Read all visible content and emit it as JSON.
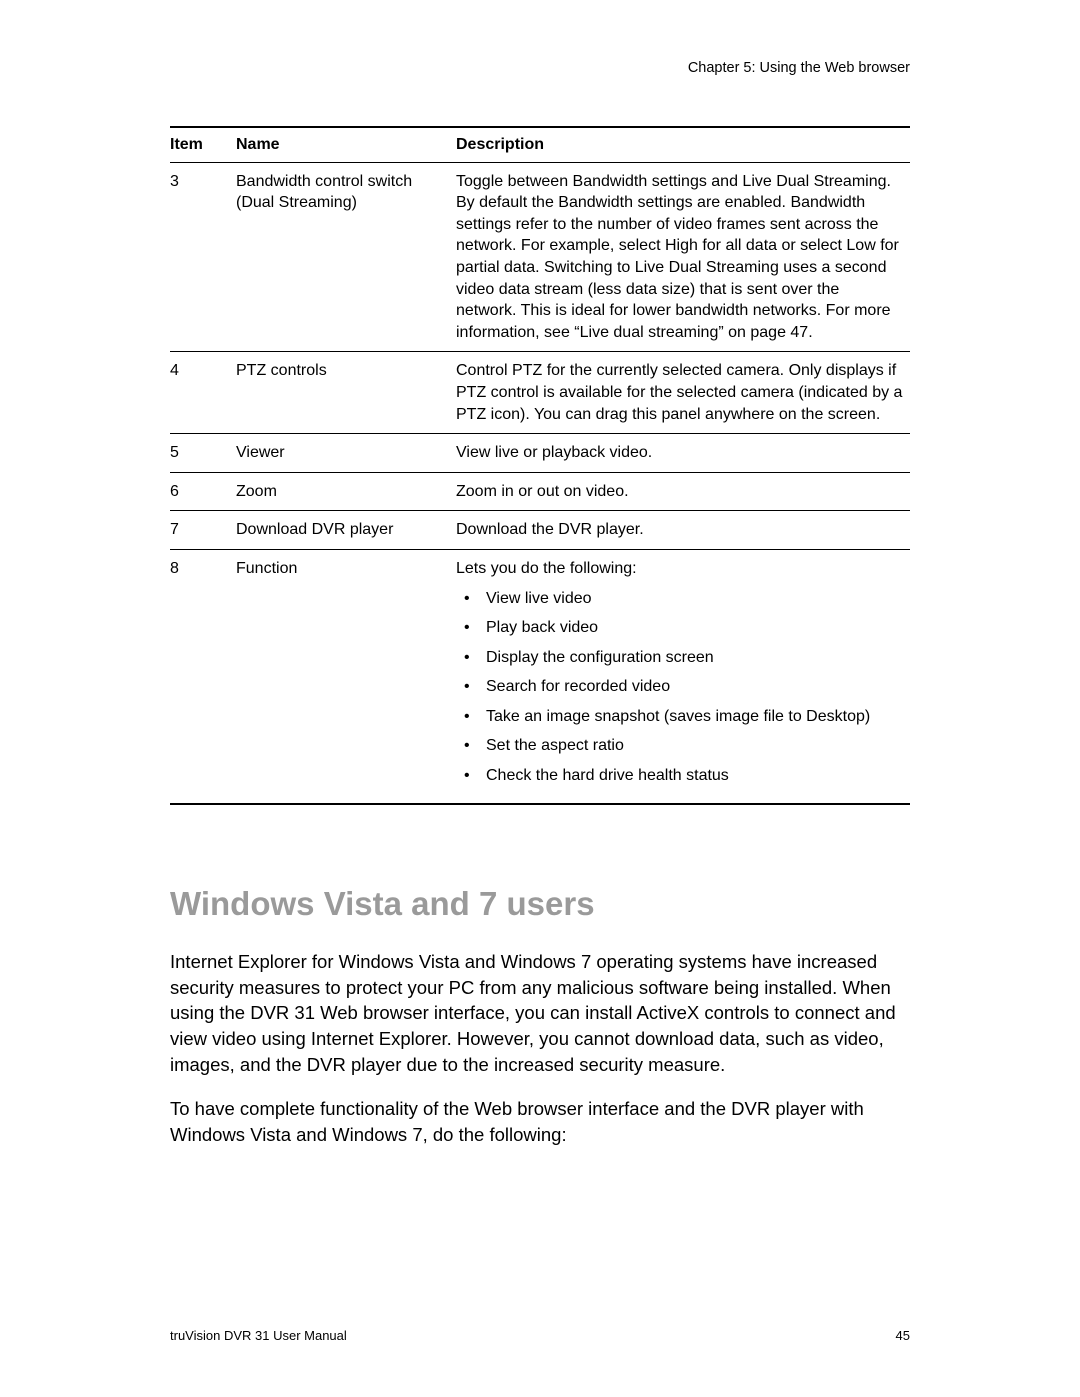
{
  "chapter_header": "Chapter 5: Using the Web browser",
  "table": {
    "headers": {
      "item": "Item",
      "name": "Name",
      "description": "Description"
    },
    "rows": [
      {
        "item": "3",
        "name": "Bandwidth control switch (Dual Streaming)",
        "desc": "Toggle between Bandwidth settings and Live Dual Streaming. By default the Bandwidth settings are enabled. Bandwidth settings refer to the number of video frames sent across the network. For example, select High for all data or select Low for partial data. Switching to Live Dual Streaming uses a second video data stream (less data size) that is sent over the network. This is ideal for lower bandwidth networks. For more information, see “Live dual streaming” on page 47."
      },
      {
        "item": "4",
        "name": "PTZ controls",
        "desc": "Control PTZ for the currently selected camera. Only displays if PTZ control is available for the selected camera (indicated by a PTZ icon). You can drag this panel anywhere on the screen."
      },
      {
        "item": "5",
        "name": "Viewer",
        "desc": "View live or playback video."
      },
      {
        "item": "6",
        "name": "Zoom",
        "desc": "Zoom in or out on video."
      },
      {
        "item": "7",
        "name": "Download DVR player",
        "desc": "Download the DVR player."
      },
      {
        "item": "8",
        "name": "Function",
        "desc_intro": "Lets you do the following:",
        "desc_list": [
          "View live video",
          "Play back video",
          "Display the configuration screen",
          "Search for recorded video",
          "Take an image snapshot (saves image file to Desktop)",
          "Set the aspect ratio",
          "Check the hard drive health status"
        ]
      }
    ]
  },
  "section_heading": "Windows Vista and 7 users",
  "paragraphs": [
    "Internet Explorer for Windows Vista and Windows 7 operating systems have increased security measures to protect your PC from any malicious software being installed. When using the DVR 31 Web browser interface, you can install ActiveX controls to connect and view video using Internet Explorer. However, you cannot download data, such as video, images, and the DVR player due to the increased security measure.",
    "To have complete functionality of the Web browser interface and the DVR player with Windows Vista and Windows 7, do the following:"
  ],
  "footer": {
    "left": "truVision DVR 31 User Manual",
    "right": "45"
  }
}
